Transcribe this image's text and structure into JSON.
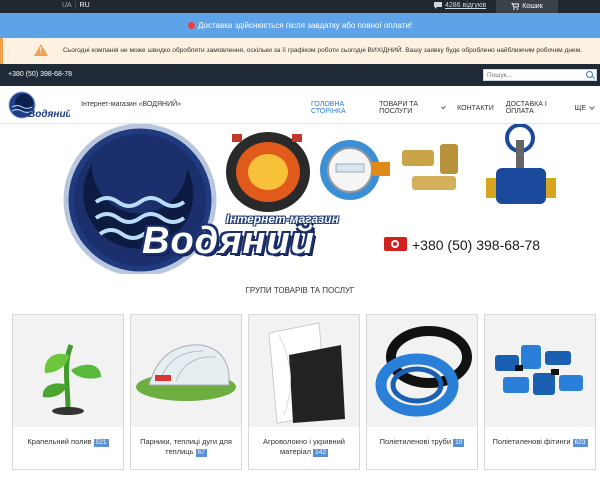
{
  "topbar": {
    "lang_ua": "UA",
    "lang_sep": "|",
    "lang_ru": "RU",
    "reviews_label": "4286 відгуків",
    "cart_label": "Кошик"
  },
  "banner_notice": {
    "text": "Доставка здійснюється після завдатку або повної оплати!"
  },
  "banner_warning": {
    "text": "Сьогодні компанія не може швидко обробляти замовлення, оскільки за її графіком роботи сьогодні ВИХІДНИЙ. Вашу заявку буде оброблено найближчим робочим днем."
  },
  "phonebar": {
    "phone": "+380 (50) 398-68-78",
    "search_placeholder": "Пошук..."
  },
  "header": {
    "logo_text": "Водяний",
    "tagline": "Інтернет-магазин «ВОДЯНИЙ»",
    "nav": [
      {
        "label": "ГОЛОВНА СТОРІНКА",
        "active": true
      },
      {
        "label": "ТОВАРИ ТА ПОСЛУГИ",
        "dropdown": true
      },
      {
        "label": "КОНТАКТИ"
      },
      {
        "label": "ДОСТАВКА І ОПЛАТА"
      },
      {
        "label": "ЩЕ",
        "dropdown": true
      }
    ]
  },
  "hero": {
    "subtitle": "Інтернет-магазин",
    "brand": "Водяний",
    "phone": "+380 (50) 398-68-78"
  },
  "section_title": "ГРУПИ ТОВАРІВ ТА ПОСЛУГ",
  "categories": [
    {
      "name": "Крапельний полив",
      "count": "521",
      "icon": "sprout-icon"
    },
    {
      "name": "Парники, теплиці дуги для теплиць",
      "count": "67",
      "icon": "greenhouse-icon"
    },
    {
      "name": "Агроволокно і укривний матеріал",
      "count": "142",
      "icon": "agrofibre-icon"
    },
    {
      "name": "Поліетиленові труби",
      "count": "10",
      "icon": "pipe-coil-icon"
    },
    {
      "name": "Поліетиленові фітинги",
      "count": "623",
      "icon": "fittings-icon"
    }
  ],
  "colors": {
    "accent": "#2b7bd6",
    "notice_bg": "#5ea2e8",
    "warning_bg": "#fdf2e1",
    "dark_bar": "#1f2a36"
  }
}
